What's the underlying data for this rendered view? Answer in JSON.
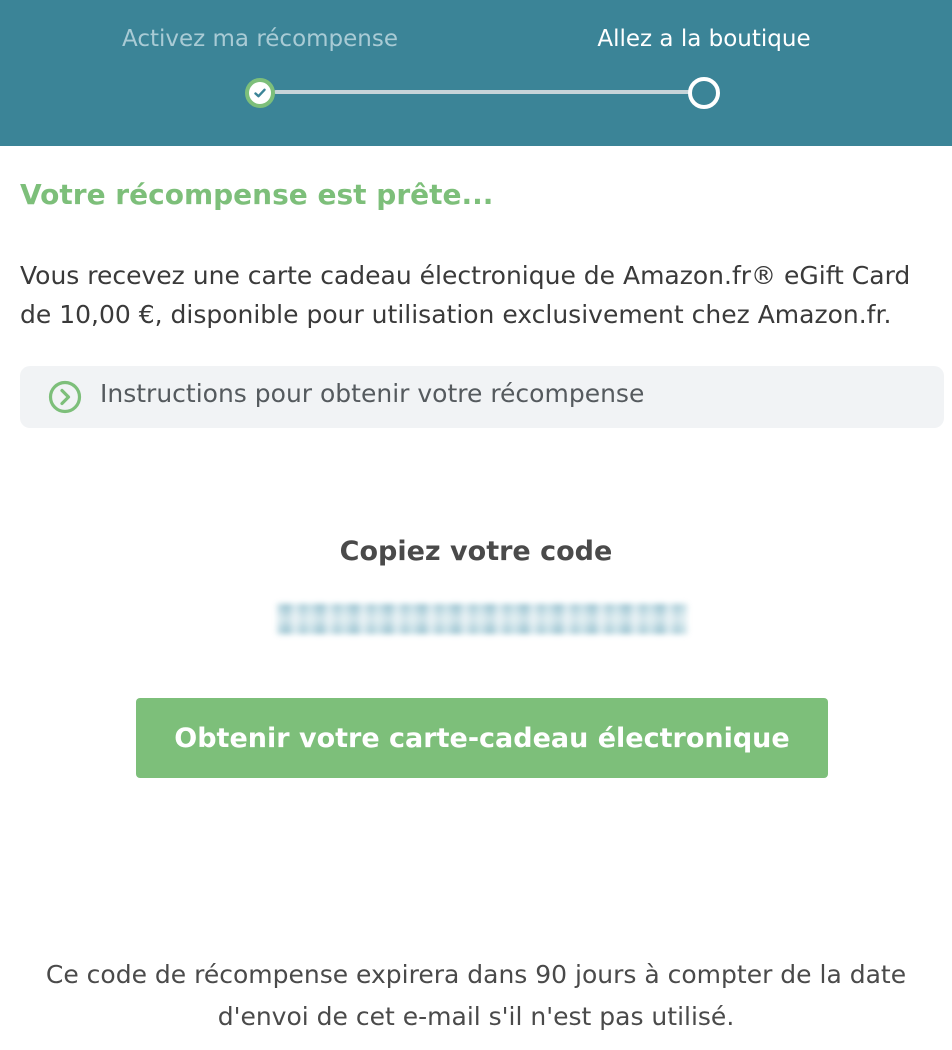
{
  "stepper": {
    "steps": [
      {
        "label": "Activez ma récompense",
        "state": "done"
      },
      {
        "label": "Allez a la boutique",
        "state": "current"
      }
    ]
  },
  "reward": {
    "title": "Votre récompense est prête...",
    "description": "Vous recevez une carte cadeau électronique de Amazon.fr® eGift Card de 10,00 €, disponible pour utilisation exclusivement chez Amazon.fr.",
    "instructions_label": "Instructions pour obtenir votre récompense"
  },
  "code": {
    "title": "Copiez votre code"
  },
  "cta": {
    "label": "Obtenir votre carte-cadeau électronique"
  },
  "footer": {
    "expiry_note": "Ce code de récompense expirera dans 90 jours à compter de la date d'envoi de cet e-mail s'il n'est pas utilisé."
  },
  "colors": {
    "header_bg": "#3b8497",
    "accent_green": "#7dbf7a",
    "panel_bg": "#f1f3f5"
  },
  "icons": {
    "step_done": "check-icon",
    "instructions": "chevron-right-circle-icon"
  }
}
